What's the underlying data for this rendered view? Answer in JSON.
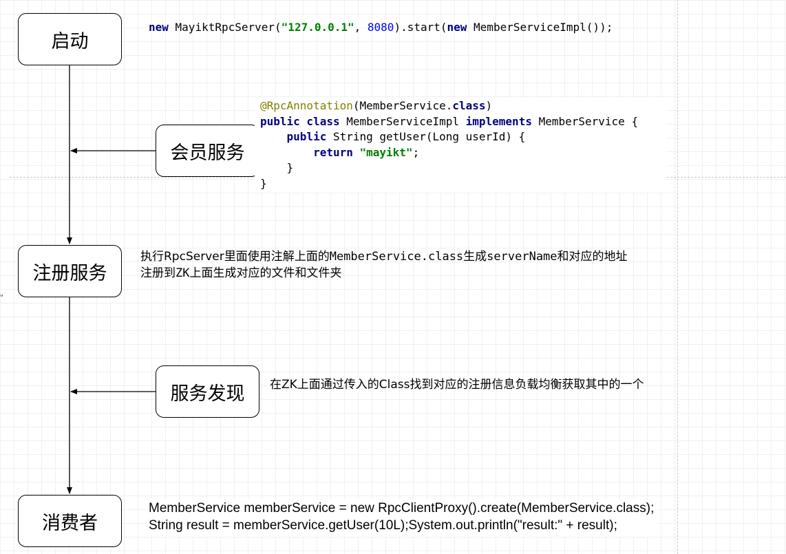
{
  "nodes": {
    "start": "启动",
    "member_service": "会员服务",
    "register": "注册服务",
    "discover": "服务发现",
    "consumer": "消费者"
  },
  "code_start": {
    "kw_new1": "new",
    "t1": " MayiktRpcServer(",
    "ip": "\"127.0.0.1\"",
    "t2": ", ",
    "port": "8080",
    "t3": ").start(",
    "kw_new2": "new",
    "t4": " MemberServiceImpl());"
  },
  "code_member": {
    "l1_ann": "@RpcAnnotation",
    "l1_t1": "(MemberService.",
    "l1_kw": "class",
    "l1_t2": ")",
    "l2_kw1": "public class",
    "l2_t1": " MemberServiceImpl ",
    "l2_kw2": "implements",
    "l2_t2": " MemberService {",
    "l3_indent": "    ",
    "l3_kw": "public",
    "l3_t": " String getUser(Long userId) {",
    "l4_indent": "        ",
    "l4_kw": "return",
    "l4_sp": " ",
    "l4_str": "\"mayikt\"",
    "l4_t": ";",
    "l5": "    }",
    "l6": "}"
  },
  "register_desc": {
    "l1_a": "执行RpcServer里面使用注解上面的",
    "l1_b": "MemberService.class",
    "l1_c": "生成",
    "l1_d": "serverName",
    "l1_e": "和对应的地址",
    "l2_a": "注册到",
    "l2_b": "ZK",
    "l2_c": "上面生成对应的文件和文件夹"
  },
  "discover_desc": "在ZK上面通过传入的Class找到对应的注册信息负载均衡获取其中的一个",
  "consumer_code": {
    "l1": "MemberService memberService = new RpcClientProxy().create(MemberService.class);",
    "l2": "String result = memberService.getUser(10L);System.out.println(\"result:\" + result);"
  },
  "stray_mark": "\""
}
